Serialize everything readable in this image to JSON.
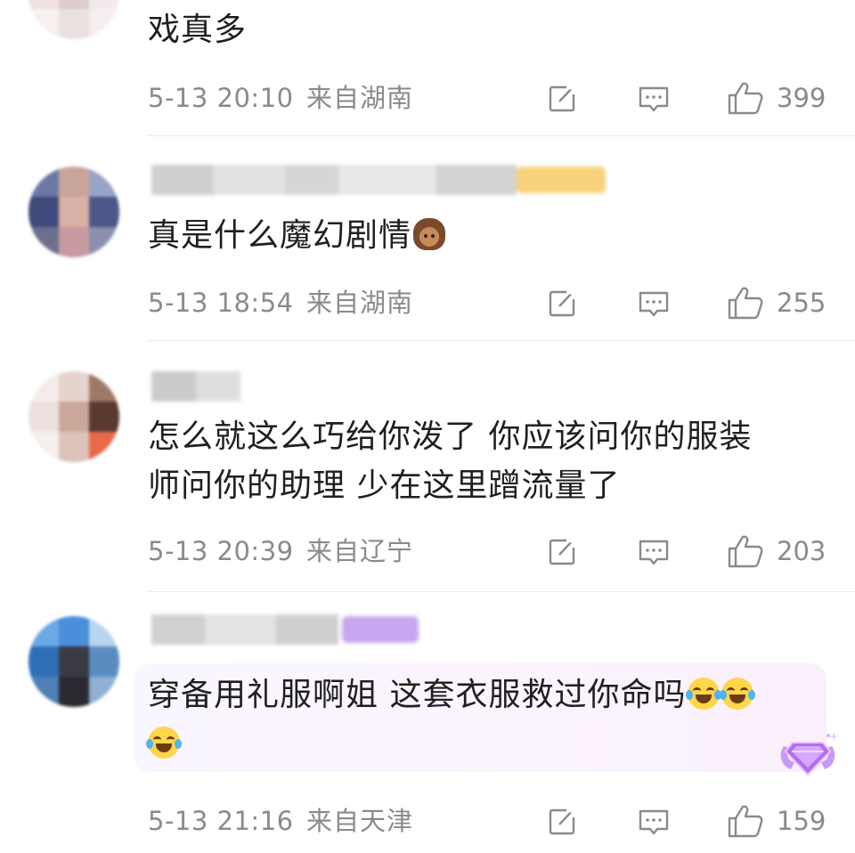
{
  "comments": [
    {
      "text": "戏真多",
      "time": "5-13 20:10",
      "location": "来自湖南",
      "likes": "399"
    },
    {
      "text": "真是什么魔幻剧情",
      "emoji_after": [
        "girl-emoji"
      ],
      "time": "5-13 18:54",
      "location": "来自湖南",
      "likes": "255"
    },
    {
      "text_line1": "怎么就这么巧给你泼了 你应该问你的服装",
      "text_line2": "师问你的助理 少在这里蹭流量了",
      "time": "5-13 20:39",
      "location": "来自辽宁",
      "likes": "203"
    },
    {
      "text": "穿备用礼服啊姐 这套衣服救过你命吗",
      "emoji_after": [
        "laugh-cry-emoji",
        "laugh-cry-emoji",
        "laugh-cry-emoji"
      ],
      "time": "5-13 21:16",
      "location": "来自天津",
      "likes": "159",
      "badge_icon": "purple-gem-badge-icon"
    }
  ],
  "icons": {
    "share": "share-edit-icon",
    "comment": "comment-bubble-icon",
    "like": "thumbs-up-icon"
  },
  "colors": {
    "meta_text": "#8a8a8a",
    "body_text": "#1f1f1f",
    "highlight_bg": "#faf6ff",
    "divider": "#ececec"
  }
}
